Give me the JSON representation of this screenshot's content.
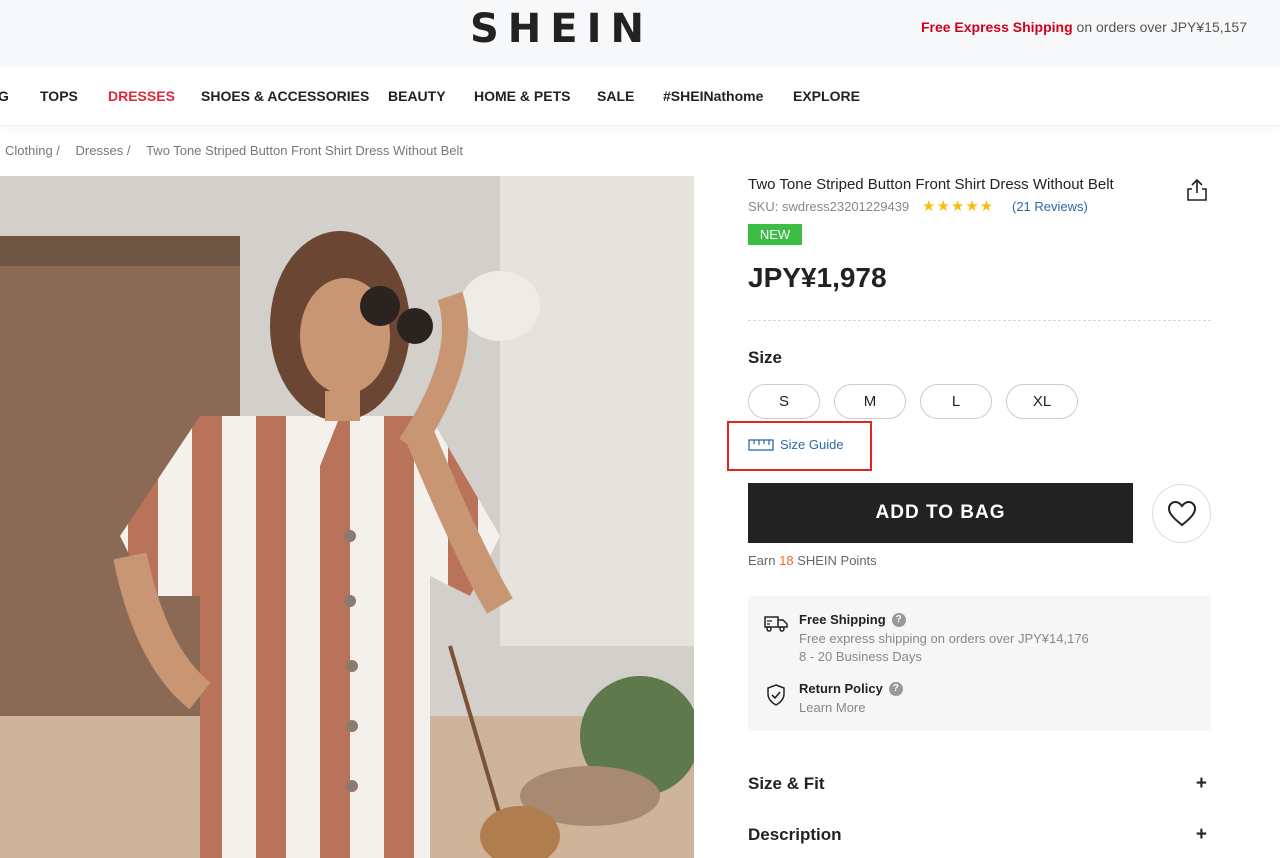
{
  "header": {
    "logo": "SHEIN",
    "promo_highlight": "Free Express Shipping",
    "promo_rest": "on orders over JPY¥15,157"
  },
  "nav": {
    "items": [
      "G",
      "TOPS",
      "DRESSES",
      "SHOES & ACCESSORIES",
      "BEAUTY",
      "HOME & PETS",
      "SALE",
      "#SHEINathome",
      "EXPLORE"
    ],
    "active": "DRESSES",
    "active_color": "#e0263c"
  },
  "breadcrumb": [
    "Clothing /",
    "Dresses /",
    "Two Tone Striped Button Front Shirt Dress Without Belt"
  ],
  "product": {
    "name": "Two Tone Striped Button Front Shirt Dress Without Belt",
    "sku": "SKU: swdress23201229439",
    "rating": 5,
    "stars": "★★★★★",
    "reviews": "(21 Reviews)",
    "badge": "NEW",
    "price": "JPY¥1,978"
  },
  "size": {
    "title": "Size",
    "options": [
      "S",
      "M",
      "L",
      "XL"
    ],
    "guide": "Size Guide"
  },
  "actions": {
    "add_to_bag": "ADD TO BAG",
    "points_prefix": "Earn",
    "points_value": "18",
    "points_suffix": "SHEIN Points"
  },
  "shipping": {
    "title": "Free Shipping",
    "desc": "Free express shipping on orders over JPY¥14,176",
    "days": "8 - 20 Business Days",
    "return_title": "Return Policy",
    "return_link": "Learn More"
  },
  "accordions": [
    "Size & Fit",
    "Description"
  ],
  "accordion_toggle": "+",
  "colors": {
    "accent_red": "#e0263c",
    "link_blue": "#2d68a8",
    "new_badge": "#3cbd45",
    "star": "#fabd0b",
    "highlight_box": "#e3261a"
  }
}
